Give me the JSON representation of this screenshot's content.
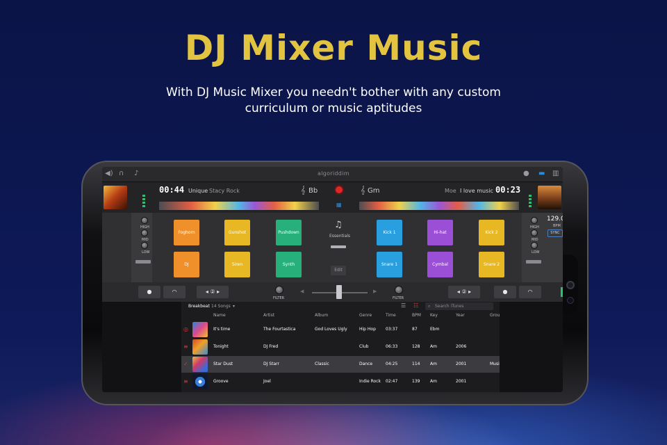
{
  "headline": "DJ Mixer Music",
  "subtitle": "With DJ Music Mixer you needn't bother with any custom curriculum or music aptitudes",
  "app": {
    "brand": "algoriddim",
    "deck_left": {
      "time": "00:44",
      "title": "Unique",
      "artist": "Stacy Rock",
      "key": "Bb"
    },
    "deck_right": {
      "time": "00:23",
      "title": "I love music",
      "artist": "Moe",
      "key": "Gm"
    },
    "bpm": "129.0",
    "bpm_unit": "BPM",
    "sync_label": "SYNC",
    "eq_labels": [
      "HIGH",
      "MID",
      "LOW"
    ],
    "center_panel": {
      "label": "Essentials",
      "edit": "Edit"
    },
    "filter_label": "FILTER",
    "pads_left": [
      {
        "label": "Foghorn",
        "color": "#f0902a"
      },
      {
        "label": "Gunshot",
        "color": "#e8b824"
      },
      {
        "label": "Pushdown",
        "color": "#27b07a"
      },
      {
        "label": "DJ",
        "color": "#f0902a"
      },
      {
        "label": "Siren",
        "color": "#e8b824"
      },
      {
        "label": "Synth",
        "color": "#27b07a"
      }
    ],
    "pads_right": [
      {
        "label": "Kick 1",
        "color": "#2a9fe0"
      },
      {
        "label": "Hi-hat",
        "color": "#9b4fd6"
      },
      {
        "label": "Kick 2",
        "color": "#e8b824"
      },
      {
        "label": "Snare 1",
        "color": "#2a9fe0"
      },
      {
        "label": "Cymbal",
        "color": "#9b4fd6"
      },
      {
        "label": "Snare 2",
        "color": "#e8b824"
      }
    ],
    "library": {
      "playlist": "Breakbeat",
      "count": "14 Songs",
      "search_placeholder": "Search iTunes",
      "columns": [
        "Name",
        "Artist",
        "Album",
        "Genre",
        "Time",
        "BPM",
        "Key",
        "Year",
        "Grou"
      ],
      "rows": [
        {
          "name": "It's time",
          "artist": "The Fourtastica",
          "album": "God Loves Ugly",
          "genre": "Hip Hop",
          "time": "03:37",
          "bpm": "87",
          "key": "Ebm",
          "year": "",
          "group": ""
        },
        {
          "name": "Tonight",
          "artist": "DJ Fred",
          "album": "",
          "genre": "Club",
          "time": "06:33",
          "bpm": "128",
          "key": "Am",
          "year": "2006",
          "group": ""
        },
        {
          "name": "Star Dust",
          "artist": "DJ Starr",
          "album": "Classic",
          "genre": "Dance",
          "time": "04:25",
          "bpm": "114",
          "key": "Am",
          "year": "2001",
          "group": "Musi"
        },
        {
          "name": "Groove",
          "artist": "Joel",
          "album": "",
          "genre": "Indie Rock",
          "time": "02:47",
          "bpm": "139",
          "key": "Am",
          "year": "2001",
          "group": ""
        }
      ]
    }
  },
  "colors": {
    "headline": "#e2c441",
    "record": "#e02525",
    "accent": "#2a9fe0"
  }
}
